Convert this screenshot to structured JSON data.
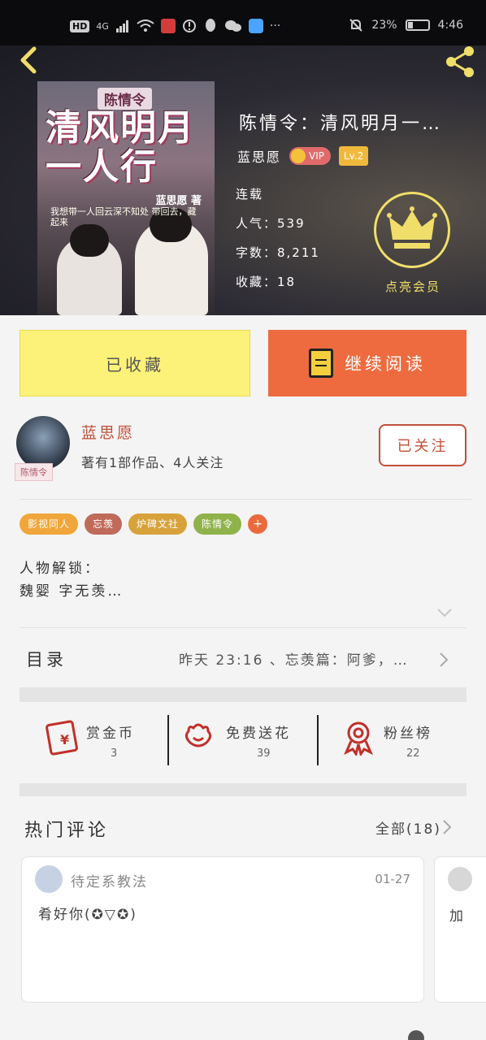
{
  "status_bar": {
    "hd": "HD",
    "signal": "4G",
    "battery_percent": "23%",
    "time": "4:46",
    "more": "···"
  },
  "book": {
    "title": "陈情令：清风明月一…",
    "author": "蓝思愿",
    "vip_label": "VIP",
    "level_label": "Lv.2",
    "status": "连载",
    "popularity": "人气：539",
    "word_count": "字数：8,211",
    "favorites": "收藏：18",
    "crown_label": "点亮会员"
  },
  "cover": {
    "badge": "陈情令",
    "title": "清风明月一人行",
    "author": "蓝思愿 著",
    "subtitle": "我想带一人回云深不知处 带回去，藏起来"
  },
  "actions": {
    "collected_label": "已收藏",
    "continue_label": "继续阅读"
  },
  "author_card": {
    "name": "蓝思愿",
    "info": "著有1部作品、4人关注",
    "avatar_tag": "陈情令",
    "follow_label": "已关注"
  },
  "tags": [
    {
      "label": "影视同人",
      "color": "#f0a63a"
    },
    {
      "label": "忘羡",
      "color": "#c06a5a"
    },
    {
      "label": "炉碑文社",
      "color": "#d8a23a"
    },
    {
      "label": "陈情令",
      "color": "#8fb24a"
    }
  ],
  "tag_more": "+",
  "intro": {
    "line1": "人物解锁：",
    "line2": "魏婴 字无羡…"
  },
  "toc": {
    "label": "目录",
    "latest": "昨天 23:16 、忘羡篇：阿爹，…"
  },
  "stats": [
    {
      "label": "赏金币",
      "value": "3",
      "icon": "red-envelope-icon"
    },
    {
      "label": "免费送花",
      "value": "39",
      "icon": "flower-icon"
    },
    {
      "label": "粉丝榜",
      "value": "22",
      "icon": "medal-icon"
    }
  ],
  "hot_comments": {
    "title": "热门评论",
    "all_label": "全部(18)",
    "items": [
      {
        "user": "待定系教法",
        "date": "01-27",
        "text": "肴好你(✪▽✪)"
      },
      {
        "text": "加"
      }
    ]
  },
  "colors": {
    "accent_orange": "#ed6b3e",
    "accent_yellow": "#fdf279",
    "author_red": "#c0503a",
    "crown_gold": "#f0de6a"
  }
}
